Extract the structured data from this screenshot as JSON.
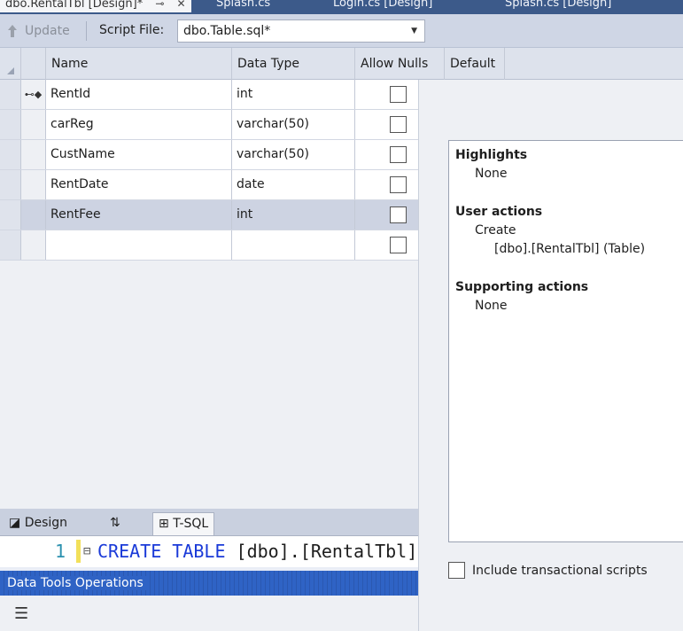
{
  "doc_tabs": [
    {
      "label": "dbo.RentalTbl [Design]*",
      "active": true
    },
    {
      "label": "Splash.cs",
      "active": false
    },
    {
      "label": "Login.cs [Design]",
      "active": false
    },
    {
      "label": "Splash.cs [Design]",
      "active": false
    }
  ],
  "toolbar": {
    "update_label": "Update",
    "script_file_label": "Script File:",
    "script_file_value": "dbo.Table.sql*"
  },
  "grid": {
    "columns": [
      "Name",
      "Data Type",
      "Allow Nulls",
      "Default"
    ],
    "rows": [
      {
        "name": "RentId",
        "type": "int",
        "allow_nulls": false,
        "primary_key": true
      },
      {
        "name": "carReg",
        "type": "varchar(50)",
        "allow_nulls": false
      },
      {
        "name": "CustName",
        "type": "varchar(50)",
        "allow_nulls": false
      },
      {
        "name": "RentDate",
        "type": "date",
        "allow_nulls": false
      },
      {
        "name": "RentFee",
        "type": "int",
        "allow_nulls": false,
        "selected": true
      },
      {
        "name": "",
        "type": "",
        "allow_nulls": false
      }
    ]
  },
  "preview": {
    "highlights_heading": "Highlights",
    "highlights_value": "None",
    "user_actions_heading": "User actions",
    "user_actions_verb": "Create",
    "user_actions_target": "[dbo].[RentalTbl] (Table)",
    "supporting_heading": "Supporting actions",
    "supporting_value": "None",
    "include_transactional_label": "Include transactional scripts"
  },
  "bottom_tabs": {
    "design": "Design",
    "swap": "⇅",
    "tsql": "T-SQL"
  },
  "script": {
    "line_number": "1",
    "keyword": "CREATE TABLE",
    "rest": " [dbo].[RentalTbl]"
  },
  "data_tools": {
    "title": "Data Tools Operations"
  }
}
